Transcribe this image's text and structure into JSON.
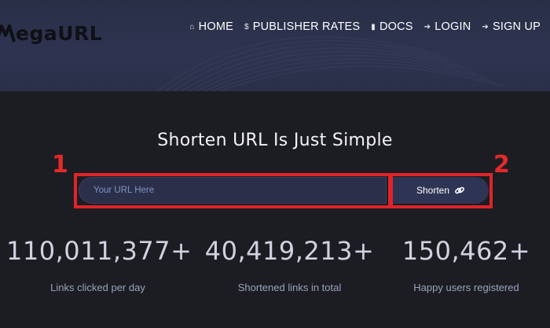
{
  "brand": {
    "logo_text": "egaURL"
  },
  "nav": [
    {
      "icon": "home-icon",
      "glyph": "⌂",
      "label": "HOME"
    },
    {
      "icon": "dollar-icon",
      "glyph": "$",
      "label": "PUBLISHER RATES"
    },
    {
      "icon": "book-icon",
      "glyph": "▮",
      "label": "DOCS"
    },
    {
      "icon": "sign-in-icon",
      "glyph": "➔",
      "label": "LOGIN"
    },
    {
      "icon": "sign-in-icon",
      "glyph": "➔",
      "label": "SIGN UP"
    }
  ],
  "hero": {
    "title": "Shorten URL Is Just Simple",
    "input_placeholder": "Your URL Here",
    "button_label": "Shorten"
  },
  "annotations": {
    "marker_1": "1",
    "marker_2": "2",
    "color": "#e0242a"
  },
  "stats": [
    {
      "value": "110,011,377+",
      "label": "Links clicked per day"
    },
    {
      "value": "40,419,213+",
      "label": "Shortened links in total"
    },
    {
      "value": "150,462+",
      "label": "Happy users registered"
    }
  ],
  "colors": {
    "header": "#2e3450",
    "body": "#1c1d22",
    "button": "#2e3554"
  }
}
